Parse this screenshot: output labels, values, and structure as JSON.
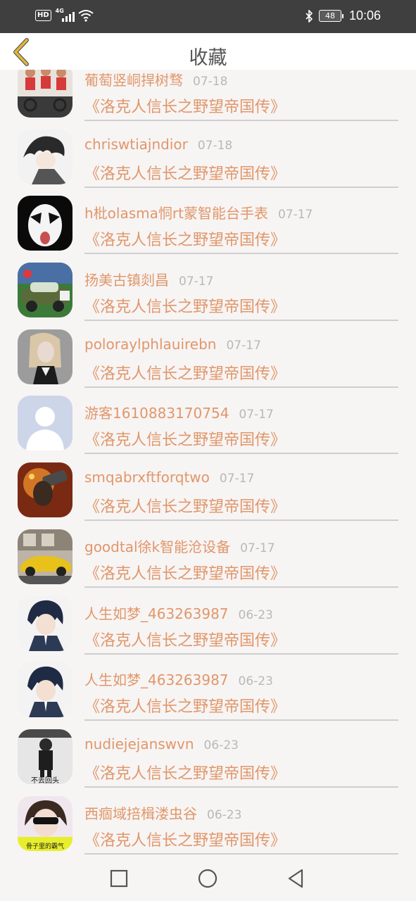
{
  "status_bar": {
    "hd": "HD",
    "network": "4G",
    "battery": "48",
    "time": "10:06"
  },
  "header": {
    "title": "收藏",
    "back_icon": "chevron-left-icon"
  },
  "items": [
    {
      "name": "葡萄竖峒捍树骛",
      "date": "07-18",
      "content": "《洛克人信长之野望帝国传》"
    },
    {
      "name": "chriswtiajndior",
      "date": "07-18",
      "content": "《洛克人信长之野望帝国传》"
    },
    {
      "name": "h枇olasma恫rt蒙智能台手表",
      "date": "07-17",
      "content": "《洛克人信长之野望帝国传》"
    },
    {
      "name": "扬美古镇剡昌",
      "date": "07-17",
      "content": "《洛克人信长之野望帝国传》"
    },
    {
      "name": "poloraylphlauirebn",
      "date": "07-17",
      "content": "《洛克人信长之野望帝国传》"
    },
    {
      "name": "游客1610883170754",
      "date": "07-17",
      "content": "《洛克人信长之野望帝国传》"
    },
    {
      "name": "smqabrxftforqtwo",
      "date": "07-17",
      "content": "《洛克人信长之野望帝国传》"
    },
    {
      "name": "goodtal徐k智能沧设备",
      "date": "07-17",
      "content": "《洛克人信长之野望帝国传》"
    },
    {
      "name": "人生如梦_463263987",
      "date": "06-23",
      "content": "《洛克人信长之野望帝国传》"
    },
    {
      "name": "人生如梦_463263987",
      "date": "06-23",
      "content": "《洛克人信长之野望帝国传》"
    },
    {
      "name": "nudiejejanswvn",
      "date": "06-23",
      "content": "《洛克人信长之野望帝国传》"
    },
    {
      "name": "西痼域掊楫溇虫谷",
      "date": "06-23",
      "content": "《洛克人信长之野望帝国传》"
    }
  ],
  "avatar_texts": {
    "a11": "不去回头",
    "a12": "骨子里的霸气"
  },
  "nav_bar": {
    "recents_icon": "square-icon",
    "home_icon": "circle-icon",
    "back_icon": "triangle-back-icon"
  },
  "colors": {
    "accent": "#e0976a",
    "date": "#b8b8b8",
    "status_bar": "#3f3f3f",
    "back_chevron": "#e3b63a"
  }
}
